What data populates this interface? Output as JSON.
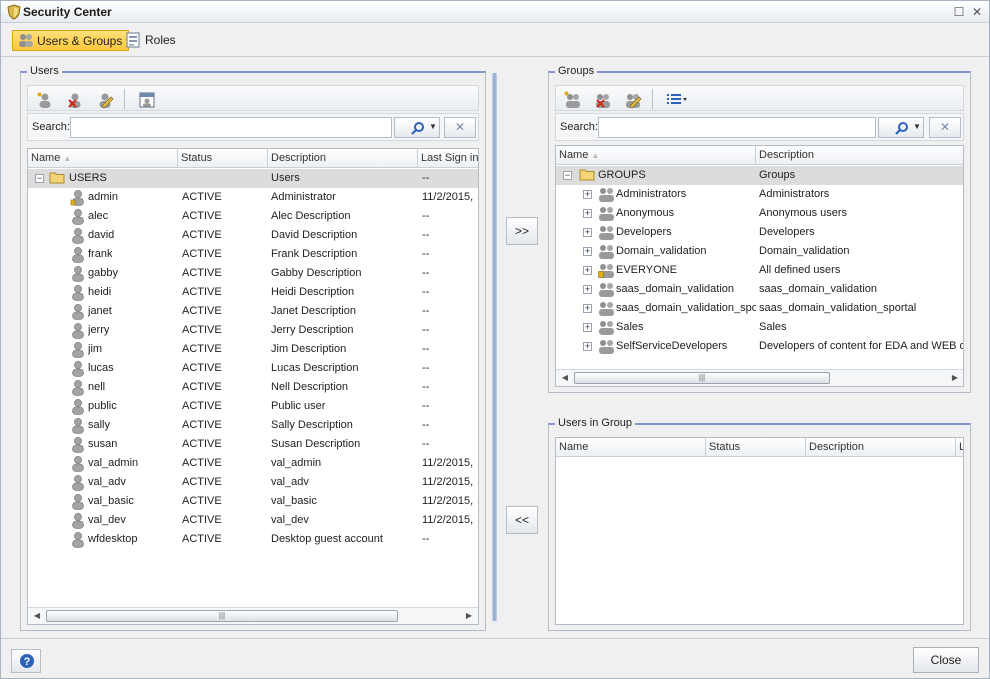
{
  "window": {
    "title": "Security Center"
  },
  "tabs": [
    {
      "label": "Users & Groups",
      "icon": "users-icon",
      "active": true
    },
    {
      "label": "Roles",
      "icon": "roles-icon",
      "active": false
    }
  ],
  "users_panel": {
    "legend": "Users",
    "search_label": "Search:",
    "search_value": "",
    "columns": [
      "Name",
      "Status",
      "Description",
      "Last Sign in"
    ],
    "root": {
      "name": "USERS",
      "status": "",
      "description": "Users",
      "last": "--"
    },
    "rows": [
      {
        "name": "admin",
        "status": "ACTIVE",
        "description": "Administrator",
        "last": "11/2/2015,",
        "icon": "admin-user-icon"
      },
      {
        "name": "alec",
        "status": "ACTIVE",
        "description": "Alec Description",
        "last": "--",
        "icon": "user-icon"
      },
      {
        "name": "david",
        "status": "ACTIVE",
        "description": "David Description",
        "last": "--",
        "icon": "user-icon"
      },
      {
        "name": "frank",
        "status": "ACTIVE",
        "description": "Frank Description",
        "last": "--",
        "icon": "user-icon"
      },
      {
        "name": "gabby",
        "status": "ACTIVE",
        "description": "Gabby Description",
        "last": "--",
        "icon": "user-icon"
      },
      {
        "name": "heidi",
        "status": "ACTIVE",
        "description": "Heidi Description",
        "last": "--",
        "icon": "user-icon"
      },
      {
        "name": "janet",
        "status": "ACTIVE",
        "description": "Janet Description",
        "last": "--",
        "icon": "user-icon"
      },
      {
        "name": "jerry",
        "status": "ACTIVE",
        "description": "Jerry Description",
        "last": "--",
        "icon": "user-icon"
      },
      {
        "name": "jim",
        "status": "ACTIVE",
        "description": "Jim Description",
        "last": "--",
        "icon": "user-icon"
      },
      {
        "name": "lucas",
        "status": "ACTIVE",
        "description": "Lucas Description",
        "last": "--",
        "icon": "user-icon"
      },
      {
        "name": "nell",
        "status": "ACTIVE",
        "description": "Nell Description",
        "last": "--",
        "icon": "user-icon"
      },
      {
        "name": "public",
        "status": "ACTIVE",
        "description": "Public user",
        "last": "--",
        "icon": "user-icon"
      },
      {
        "name": "sally",
        "status": "ACTIVE",
        "description": "Sally Description",
        "last": "--",
        "icon": "user-icon"
      },
      {
        "name": "susan",
        "status": "ACTIVE",
        "description": "Susan Description",
        "last": "--",
        "icon": "user-icon"
      },
      {
        "name": "val_admin",
        "status": "ACTIVE",
        "description": "val_admin",
        "last": "11/2/2015,",
        "icon": "user-icon"
      },
      {
        "name": "val_adv",
        "status": "ACTIVE",
        "description": "val_adv",
        "last": "11/2/2015,",
        "icon": "user-icon"
      },
      {
        "name": "val_basic",
        "status": "ACTIVE",
        "description": "val_basic",
        "last": "11/2/2015,",
        "icon": "user-icon"
      },
      {
        "name": "val_dev",
        "status": "ACTIVE",
        "description": "val_dev",
        "last": "11/2/2015,",
        "icon": "user-icon"
      },
      {
        "name": "wfdesktop",
        "status": "ACTIVE",
        "description": "Desktop guest account",
        "last": "--",
        "icon": "user-icon"
      }
    ]
  },
  "groups_panel": {
    "legend": "Groups",
    "search_label": "Search:",
    "search_value": "",
    "columns": [
      "Name",
      "Description"
    ],
    "root": {
      "name": "GROUPS",
      "description": "Groups"
    },
    "rows": [
      {
        "name": "Administrators",
        "description": "Administrators",
        "icon": "group-icon"
      },
      {
        "name": "Anonymous",
        "description": "Anonymous users",
        "icon": "group-icon"
      },
      {
        "name": "Developers",
        "description": "Developers",
        "icon": "group-icon"
      },
      {
        "name": "Domain_validation",
        "description": "Domain_validation",
        "icon": "group-icon"
      },
      {
        "name": "EVERYONE",
        "description": "All defined users",
        "icon": "everyone-group-icon"
      },
      {
        "name": "saas_domain_validation",
        "description": "saas_domain_validation",
        "icon": "group-icon"
      },
      {
        "name": "saas_domain_validation_sportal",
        "description": "saas_domain_validation_sportal",
        "icon": "group-icon"
      },
      {
        "name": "Sales",
        "description": "Sales",
        "icon": "group-icon"
      },
      {
        "name": "SelfServiceDevelopers",
        "description": "Developers of content for EDA and WEB only",
        "icon": "group-icon"
      }
    ]
  },
  "users_in_group_panel": {
    "legend": "Users in Group",
    "columns": [
      "Name",
      "Status",
      "Description",
      "L"
    ]
  },
  "buttons": {
    "add": ">>",
    "remove": "<<",
    "close": "Close"
  },
  "colors": {
    "accent_tab": "#ffc83a",
    "panel_rule": "#7e9bc8",
    "root_row": "#dcdcdc"
  }
}
